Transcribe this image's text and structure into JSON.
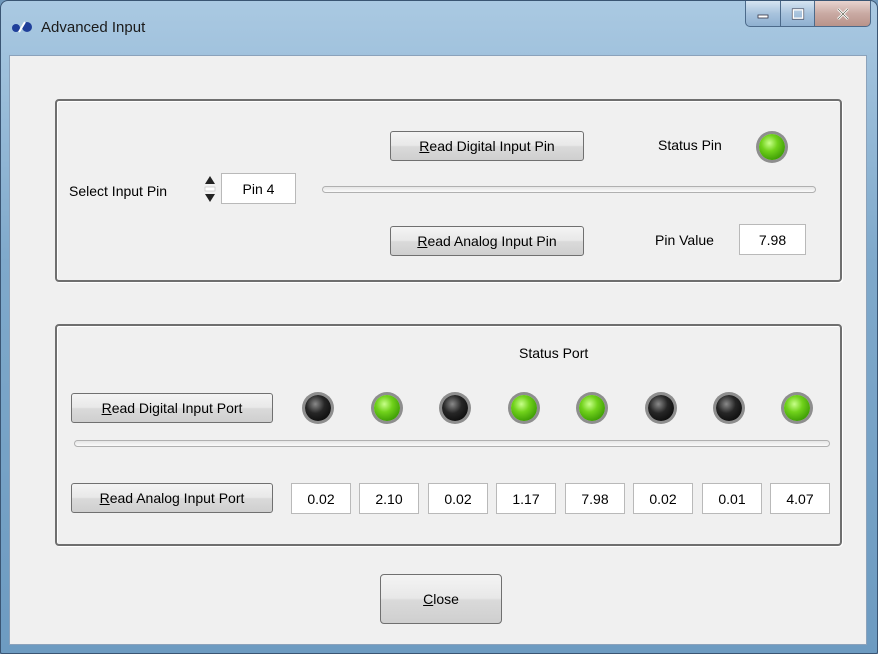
{
  "window": {
    "title": "Advanced Input",
    "app_icon": "pickit-icon"
  },
  "pin_group": {
    "select_label": "Select Input Pin",
    "pin_value_selected": "Pin 4",
    "read_digital_button": {
      "mnemonic": "R",
      "rest": "ead Digital Input Pin"
    },
    "read_analog_button": {
      "mnemonic": "R",
      "rest": "ead Analog Input Pin"
    },
    "status_pin_label": "Status Pin",
    "status_pin_state": "on",
    "pin_value_label": "Pin Value",
    "pin_value": "7.98"
  },
  "port_group": {
    "status_port_label": "Status Port",
    "read_digital_button": {
      "mnemonic": "R",
      "rest": "ead Digital Input Port"
    },
    "read_analog_button": {
      "mnemonic": "R",
      "rest": "ead Analog Input Port"
    },
    "leds": [
      "off",
      "on",
      "off",
      "on",
      "on",
      "off",
      "off",
      "on"
    ],
    "values": [
      "0.02",
      "2.10",
      "0.02",
      "1.17",
      "7.98",
      "0.02",
      "0.01",
      "4.07"
    ]
  },
  "close_button": {
    "mnemonic": "C",
    "rest": "lose"
  },
  "colors": {
    "led_on": "#5cc410",
    "led_off": "#111111"
  }
}
